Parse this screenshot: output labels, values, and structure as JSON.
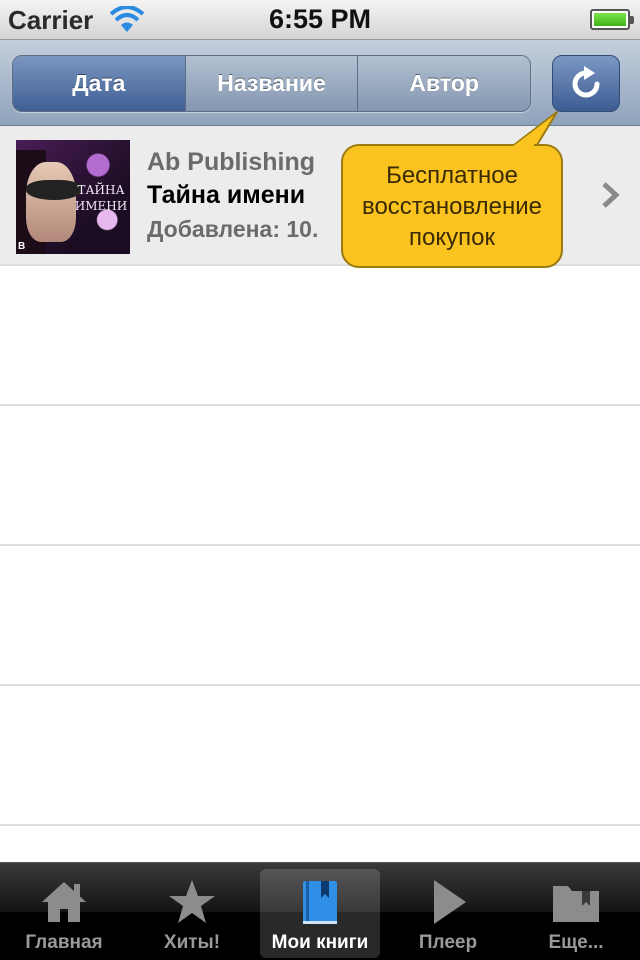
{
  "status_bar": {
    "carrier": "Carrier",
    "time": "6:55 PM"
  },
  "toolbar": {
    "segments": [
      {
        "label": "Дата",
        "selected": true
      },
      {
        "label": "Название",
        "selected": false
      },
      {
        "label": "Автор",
        "selected": false
      }
    ],
    "refresh_icon": "refresh-icon"
  },
  "books": [
    {
      "publisher": "Ab Publishing",
      "title": "Тайна имени",
      "added": "Добавлена: 10.",
      "cover_title": "ТАЙНА ИМЕНИ"
    }
  ],
  "tooltip": {
    "text": "Бесплатное восстановление покупок"
  },
  "tabbar": {
    "tabs": [
      {
        "label": "Главная",
        "icon": "home-icon",
        "selected": false
      },
      {
        "label": "Хиты!",
        "icon": "star-icon",
        "selected": false
      },
      {
        "label": "Мои книги",
        "icon": "book-icon",
        "selected": true
      },
      {
        "label": "Плеер",
        "icon": "play-icon",
        "selected": false
      },
      {
        "label": "Еще...",
        "icon": "folder-icon",
        "selected": false
      }
    ]
  },
  "colors": {
    "tooltip": "#fbc31f",
    "segment_selected": "#3f5f93",
    "accent_blue": "#3c5c92"
  }
}
